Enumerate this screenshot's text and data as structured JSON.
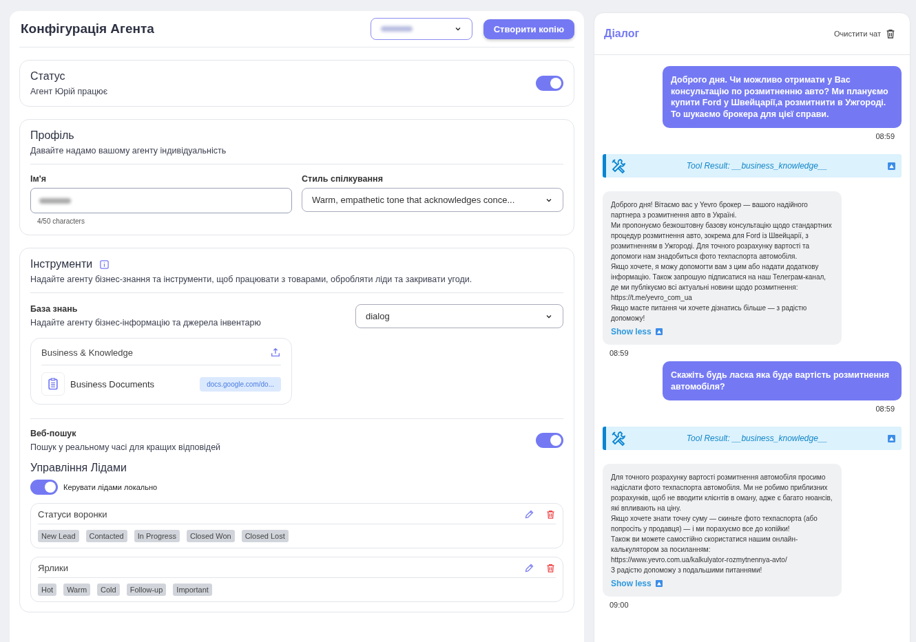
{
  "config": {
    "title": "Конфігурація Агента",
    "copy_button": "Створити копію"
  },
  "status": {
    "title": "Статус",
    "subtitle": "Агент Юрій працює",
    "on": true
  },
  "profile": {
    "title": "Профіль",
    "subtitle": "Давайте надамо вашому агенту індивідуальність",
    "name_label": "Ім'я",
    "name_hint": "4/50 characters",
    "style_label": "Стиль спілкування",
    "style_value": "Warm, empathetic tone that acknowledges conce..."
  },
  "tools": {
    "title": "Інструменти",
    "subtitle": "Надайте агенту бізнес-знання та інструменти, щоб працювати з товарами, обробляти ліди та закривати угоди.",
    "knowledge": {
      "title": "База знань",
      "subtitle": "Надайте агенту бізнес-інформацію та джерела інвентарю",
      "select_value": "dialog",
      "card_title": "Business & Knowledge",
      "doc_name": "Business Documents",
      "doc_link": "docs.google.com/do..."
    },
    "web_search": {
      "title": "Веб-пошук",
      "subtitle": "Пошук у реальному часі для кращих відповідей",
      "on": true
    },
    "leads": {
      "title": "Управління Лідами",
      "local_label": "Керувати лідами локально",
      "local_on": true,
      "groups": [
        {
          "title": "Статуси воронки",
          "tags": [
            "New Lead",
            "Contacted",
            "In Progress",
            "Closed Won",
            "Closed Lost"
          ]
        },
        {
          "title": "Ярлики",
          "tags": [
            "Hot",
            "Warm",
            "Cold",
            "Follow-up",
            "Important"
          ]
        }
      ]
    }
  },
  "dialog": {
    "title": "Діалог",
    "clear_button": "Очистити чат",
    "messages": [
      {
        "kind": "user",
        "text": "Доброго дня. Чи можливо отримати у Вас консультацію по розмитненню авто? Ми плануємо купити Ford у Швейцарії,а розмитнити в Ужгороді. То шукаємо брокера для цієї справи.",
        "time": "08:59"
      },
      {
        "kind": "tool",
        "text": "Tool Result: __business_knowledge__"
      },
      {
        "kind": "bot",
        "paragraphs": [
          "Доброго дня! Вітаємо вас у Yevro брокер — вашого надійного партнера з розмитнення авто в Україні.",
          "Ми пропонуємо безкоштовну базову консультацію щодо стандартних процедур розмитнення авто, зокрема для Ford із Швейцарії, з розмитненням в Ужгороді. Для точного розрахунку вартості та допомоги нам знадобиться фото техпаспорта автомобіля.",
          "Якщо хочете, я можу допомогти вам з цим або надати додаткову інформацію. Також запрошую підписатися на наш Телеграм-канал, де ми публікуємо всі актуальні новини щодо розмитнення: https://t.me/yevro_com_ua",
          "Якщо маєте питання чи хочете дізнатись більше — з радістю допоможу!"
        ],
        "toggle": "Show less",
        "time": "08:59"
      },
      {
        "kind": "user",
        "text": "Скажіть будь ласка яка буде вартість розмитнення автомобіля?",
        "time": "08:59"
      },
      {
        "kind": "tool",
        "text": "Tool Result: __business_knowledge__"
      },
      {
        "kind": "bot",
        "paragraphs": [
          "Для точного розрахунку вартості розмитнення автомобіля просимо надіслати фото техпаспорта автомобіля. Ми не робимо приблизних розрахунків, щоб не вводити клієнтів в оману, адже є багато нюансів, які впливають на ціну.",
          "Якщо хочете знати точну суму — скиньте фото техпаспорта (або попросіть у продавця) — і ми порахуємо все до копійки!",
          "Також ви можете самостійно скористатися нашим онлайн-калькулятором за посиланням:",
          "https://www.yevro.com.ua/kalkulyator-rozmytnennya-avto/",
          "З радістю допоможу з подальшими питаннями!"
        ],
        "toggle": "Show less",
        "time": "09:00"
      }
    ]
  }
}
